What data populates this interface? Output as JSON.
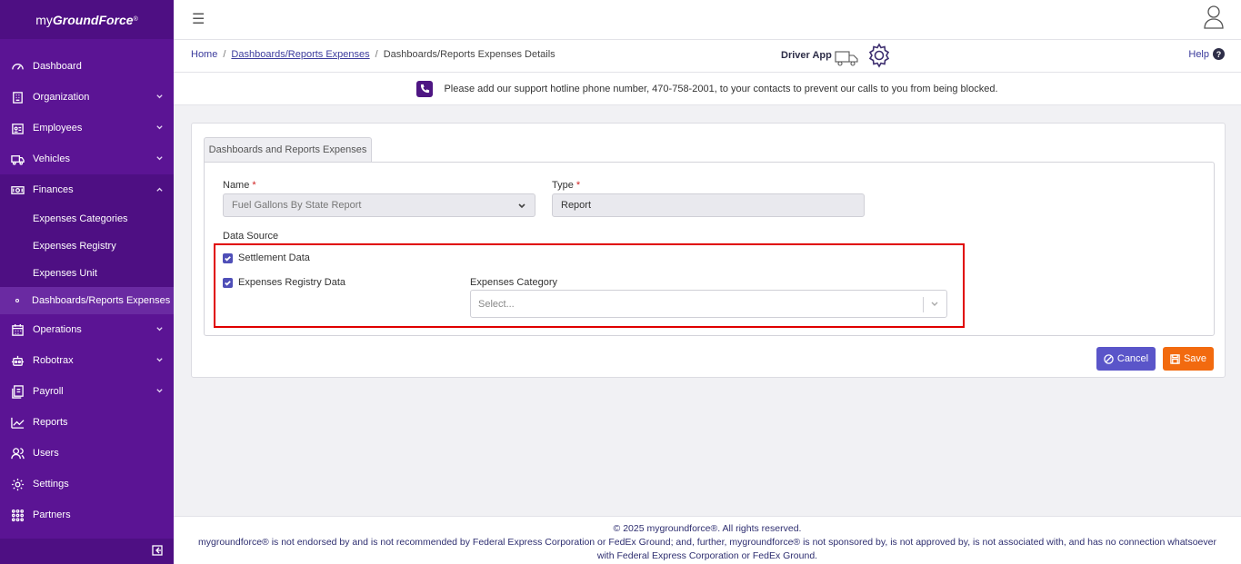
{
  "brand": {
    "prefix": "my",
    "name": "GroundForce",
    "mark": "®"
  },
  "sidebar": {
    "items": [
      {
        "label": "Dashboard",
        "icon": "dashboard-gauge-icon"
      },
      {
        "label": "Organization",
        "icon": "building-icon"
      },
      {
        "label": "Employees",
        "icon": "id-card-icon"
      },
      {
        "label": "Vehicles",
        "icon": "truck-icon"
      },
      {
        "label": "Finances",
        "icon": "money-icon"
      },
      {
        "label": "Operations",
        "icon": "calendar-icon"
      },
      {
        "label": "Robotrax",
        "icon": "robot-icon"
      },
      {
        "label": "Payroll",
        "icon": "payroll-icon"
      },
      {
        "label": "Reports",
        "icon": "chart-line-icon"
      },
      {
        "label": "Users",
        "icon": "users-icon"
      },
      {
        "label": "Settings",
        "icon": "gear-icon"
      },
      {
        "label": "Partners",
        "icon": "grid-icon"
      }
    ],
    "finances_sub": [
      {
        "label": "Expenses Categories"
      },
      {
        "label": "Expenses Registry"
      },
      {
        "label": "Expenses Unit"
      },
      {
        "label": "Dashboards/Reports Expenses"
      }
    ]
  },
  "breadcrumb": {
    "home": "Home",
    "sep": "/",
    "parent": "Dashboards/Reports Expenses",
    "current": "Dashboards/Reports Expenses Details"
  },
  "header": {
    "driver_app": "Driver App",
    "help": "Help",
    "help_icon": "?"
  },
  "notice": {
    "text": "Please add our support hotline phone number, 470-758-2001, to your contacts to prevent our calls to you from being blocked."
  },
  "form": {
    "tab": "Dashboards and Reports Expenses",
    "name_label": "Name",
    "name_value": "Fuel Gallons By State Report",
    "type_label": "Type",
    "type_value": "Report",
    "required_mark": "*",
    "data_source_label": "Data Source",
    "settlement_label": "Settlement Data",
    "expenses_registry_label": "Expenses Registry Data",
    "category_label": "Expenses Category",
    "category_placeholder": "Select..."
  },
  "actions": {
    "cancel": "Cancel",
    "save": "Save"
  },
  "footer": {
    "line1": "© 2025 mygroundforce®. All rights reserved.",
    "line2": "mygroundforce® is not endorsed by and is not recommended by Federal Express Corporation or FedEx Ground; and, further, mygroundforce® is not sponsored by, is not approved by, is not associated with, and has no connection whatsoever",
    "line3": "with Federal Express Corporation or FedEx Ground."
  },
  "colors": {
    "sidebar": "#5b1494",
    "accent": "#5a55c9",
    "save": "#f26a0f",
    "highlight": "#e00000"
  }
}
